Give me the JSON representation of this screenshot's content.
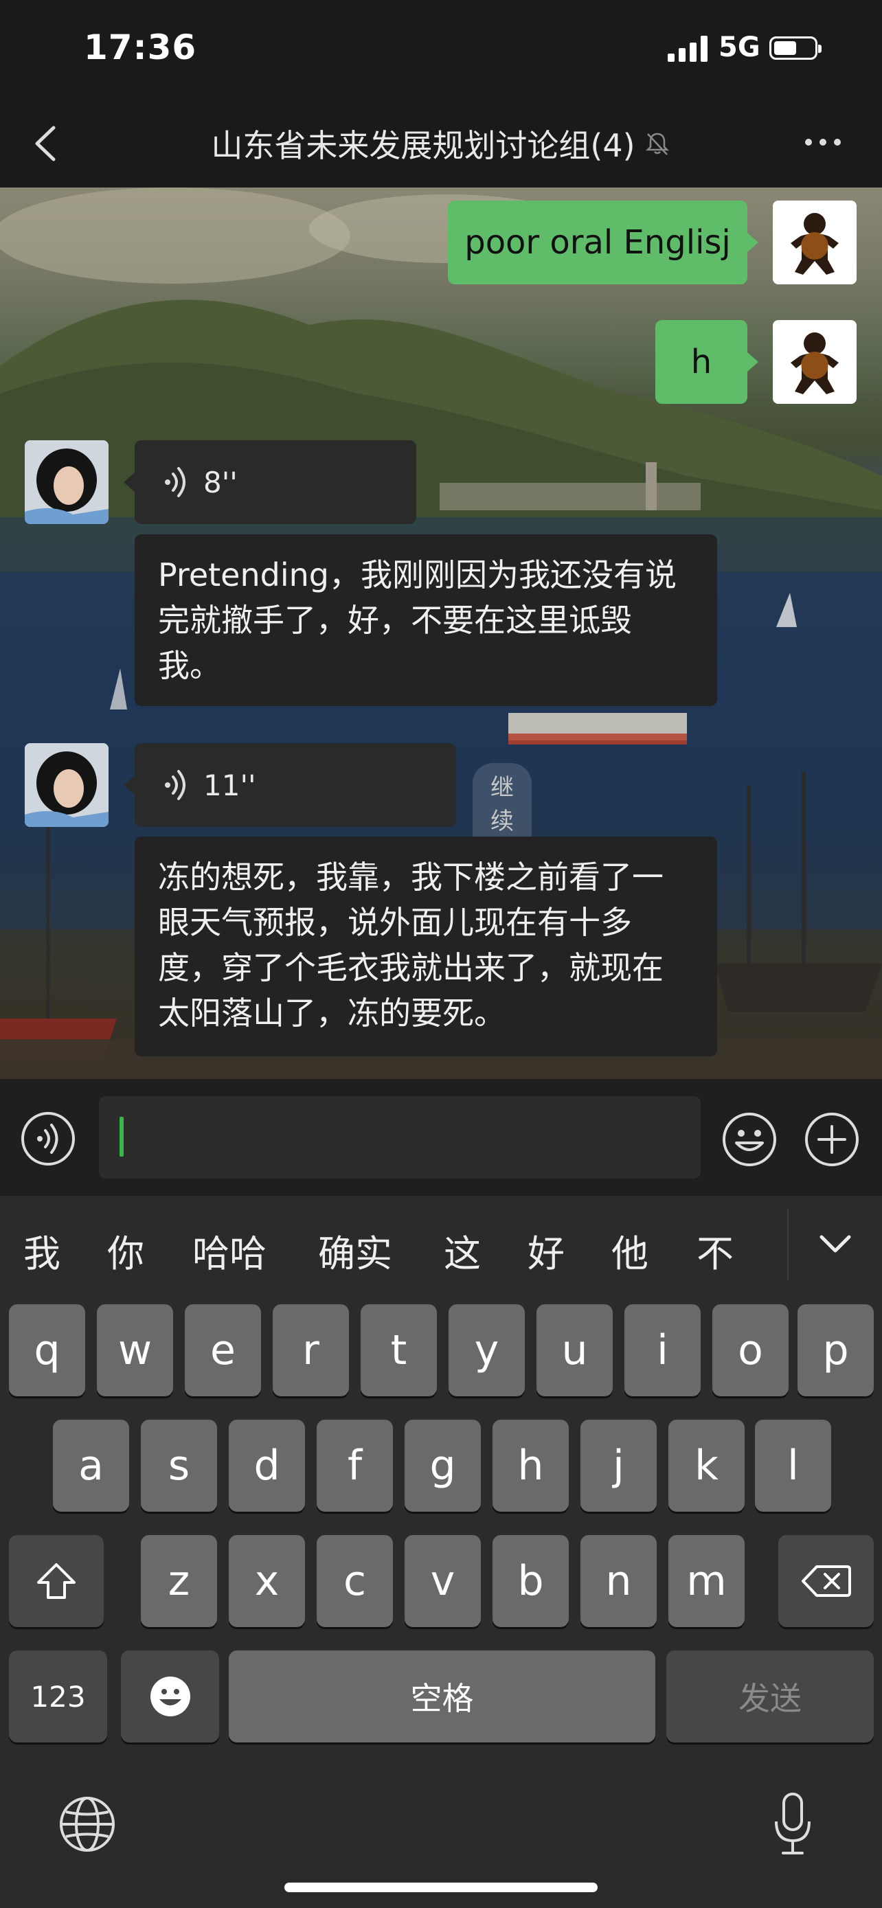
{
  "status_bar": {
    "time": "17:36",
    "network": "5G"
  },
  "header": {
    "title": "山东省未来发展规划讨论组(4)"
  },
  "messages": [
    {
      "side": "right",
      "type": "text",
      "text": "poor oral Englisj"
    },
    {
      "side": "right",
      "type": "text",
      "text": "h"
    },
    {
      "side": "left",
      "type": "voice",
      "duration": "8''",
      "transcript": "Pretending，我刚刚因为我还没有说完就撤手了，好，不要在这里诋毁我。"
    },
    {
      "side": "left",
      "type": "voice",
      "duration": "11''",
      "badge": "继续播放",
      "transcript": "冻的想死，我靠，我下楼之前看了一眼天气预报，说外面儿现在有十多度，穿了个毛衣我就出来了，就现在太阳落山了，冻的要死。"
    }
  ],
  "input": {
    "value": ""
  },
  "keyboard": {
    "candidates": [
      "我",
      "你",
      "哈哈",
      "确实",
      "这",
      "好",
      "他",
      "不"
    ],
    "row1": [
      "q",
      "w",
      "e",
      "r",
      "t",
      "y",
      "u",
      "i",
      "o",
      "p"
    ],
    "row2": [
      "a",
      "s",
      "d",
      "f",
      "g",
      "h",
      "j",
      "k",
      "l"
    ],
    "row3": [
      "z",
      "x",
      "c",
      "v",
      "b",
      "n",
      "m"
    ],
    "numbers_key": "123",
    "space_key": "空格",
    "send_key": "发送"
  },
  "colors": {
    "sent_bubble": "#5fbd69",
    "received_bubble": "#2a2a2a",
    "cursor": "#39b54a"
  }
}
